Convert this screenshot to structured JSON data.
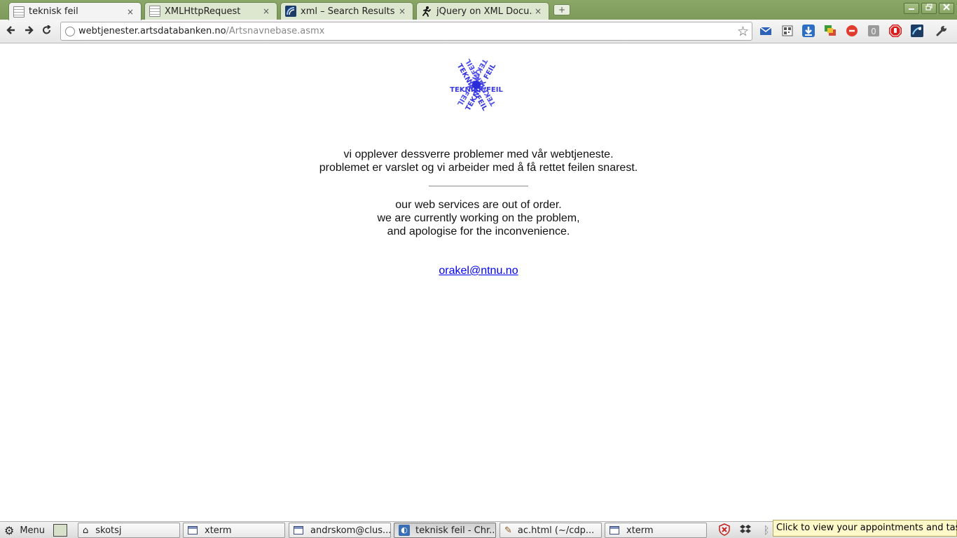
{
  "browser": {
    "tabs": [
      {
        "label": "teknisk feil",
        "icon": "page-icon",
        "active": true
      },
      {
        "label": "XMLHttpRequest",
        "icon": "page-icon",
        "active": false
      },
      {
        "label": "xml – Search Results ...",
        "icon": "stackoverflow-icon",
        "active": false
      },
      {
        "label": "jQuery on XML Docu...",
        "icon": "runner-icon",
        "active": false
      }
    ],
    "close_glyph": "×",
    "new_tab_glyph": "+",
    "address": {
      "host": "webtjenester.artsdatabanken.no",
      "path": "/Artsnavnebase.asmx"
    }
  },
  "page": {
    "logo_text": "TEKNISK FEIL",
    "norwegian_lines": [
      "vi opplever dessverre problemer med vår webtjeneste.",
      "problemet er varslet og vi arbeider med å få rettet feilen snarest."
    ],
    "english_lines": [
      "our web services are out of order.",
      "we are currently working on the problem,",
      "and apologise for the inconvenience."
    ],
    "contact_email": "orakel@ntnu.no"
  },
  "taskbar": {
    "menu_label": "Menu",
    "tasks": [
      {
        "label": "skotsj",
        "icon": "home-icon",
        "active": false
      },
      {
        "label": "xterm",
        "icon": "window-icon",
        "active": false
      },
      {
        "label": "andrskom@clus...",
        "icon": "window-icon",
        "active": false
      },
      {
        "label": "teknisk feil - Chr...",
        "icon": "chrome-icon",
        "active": true
      },
      {
        "label": "ac.html (~/cdp...",
        "icon": "editor-icon",
        "active": false
      },
      {
        "label": "xterm",
        "icon": "window-icon",
        "active": false
      }
    ],
    "tooltip": "Click to view your appointments and tasks"
  },
  "colors": {
    "tab_strip": "#7d9a5a",
    "logo_blue": "#2a2ad8",
    "link": "#0000ee"
  }
}
